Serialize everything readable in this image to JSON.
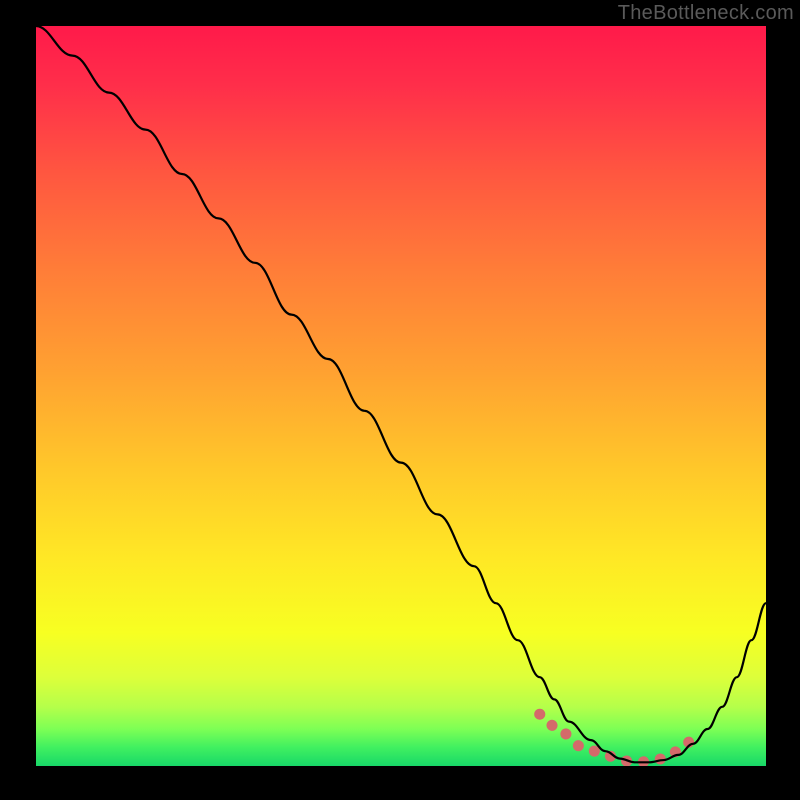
{
  "watermark": "TheBottleneck.com",
  "chart_data": {
    "type": "line",
    "title": "",
    "xlabel": "",
    "ylabel": "",
    "xlim": [
      0,
      100
    ],
    "ylim": [
      0,
      100
    ],
    "series": [
      {
        "name": "bottleneck-curve",
        "x": [
          0,
          5,
          10,
          15,
          20,
          25,
          30,
          35,
          40,
          45,
          50,
          55,
          60,
          63,
          66,
          69,
          71,
          73,
          76,
          78,
          80,
          82,
          84,
          86,
          88,
          90,
          92,
          94,
          96,
          98,
          100
        ],
        "values": [
          100,
          96,
          91,
          86,
          80,
          74,
          68,
          61,
          55,
          48,
          41,
          34,
          27,
          22,
          17,
          12,
          9,
          6,
          3.5,
          2,
          1,
          0.5,
          0.5,
          0.8,
          1.5,
          3,
          5,
          8,
          12,
          17,
          22
        ]
      },
      {
        "name": "optimal-region",
        "x": [
          69,
          72,
          75,
          78,
          80,
          82,
          84,
          86,
          88,
          90
        ],
        "values": [
          7,
          4.5,
          2.5,
          1.5,
          0.8,
          0.5,
          0.6,
          1,
          2,
          3.5
        ]
      }
    ],
    "gradient_stops": [
      {
        "offset": 0.0,
        "color": "#ff1a4a"
      },
      {
        "offset": 0.08,
        "color": "#ff2e4a"
      },
      {
        "offset": 0.2,
        "color": "#ff5740"
      },
      {
        "offset": 0.33,
        "color": "#ff7d38"
      },
      {
        "offset": 0.47,
        "color": "#ffa231"
      },
      {
        "offset": 0.6,
        "color": "#ffc82a"
      },
      {
        "offset": 0.72,
        "color": "#ffe825"
      },
      {
        "offset": 0.82,
        "color": "#f7ff22"
      },
      {
        "offset": 0.88,
        "color": "#ddff3a"
      },
      {
        "offset": 0.92,
        "color": "#b5ff4a"
      },
      {
        "offset": 0.95,
        "color": "#7dff55"
      },
      {
        "offset": 0.975,
        "color": "#40f060"
      },
      {
        "offset": 1.0,
        "color": "#18d868"
      }
    ]
  }
}
